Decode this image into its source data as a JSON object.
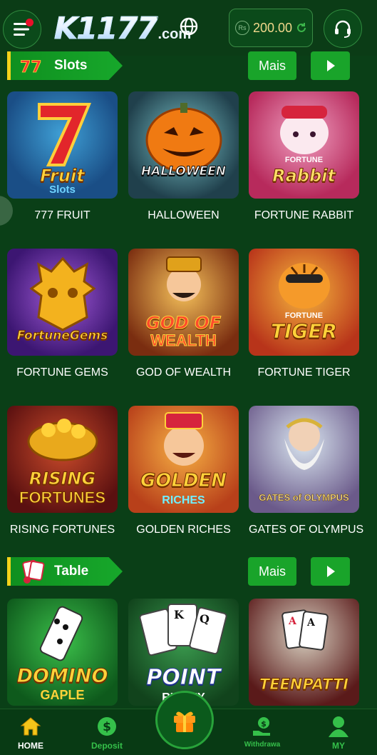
{
  "header": {
    "logo_main": "K1177",
    "logo_sub": ".com",
    "balance_currency": "Rs",
    "balance_amount": "200.00",
    "icons": [
      "menu-icon",
      "globe-icon",
      "refresh-icon",
      "headset-icon"
    ]
  },
  "sections": {
    "slots": {
      "label": "Slots",
      "more": "Mais"
    },
    "table": {
      "label": "Table",
      "more": "Mais"
    }
  },
  "games": {
    "slots": [
      {
        "name": "777 FRUIT",
        "art_title": "Fruit",
        "art_sub": "Slots"
      },
      {
        "name": "HALLOWEEN",
        "art_title": "HALLOWEEN",
        "art_sub": ""
      },
      {
        "name": "FORTUNE RABBIT",
        "art_title": "Rabbit",
        "art_sub": "FORTUNE"
      },
      {
        "name": "FORTUNE GEMS",
        "art_title": "FortuneGems",
        "art_sub": ""
      },
      {
        "name": "GOD OF WEALTH",
        "art_title": "GOD OF",
        "art_sub": "WEALTH"
      },
      {
        "name": "FORTUNE TIGER",
        "art_title": "TIGER",
        "art_sub": "FORTUNE"
      },
      {
        "name": "RISING FORTUNES",
        "art_title": "RISING",
        "art_sub": "FORTUNES"
      },
      {
        "name": "GOLDEN RICHES",
        "art_title": "GOLDEN",
        "art_sub": "RICHES"
      },
      {
        "name": "GATES OF OLYMPUS",
        "art_title": "",
        "art_sub": "GATES of OLYMPUS"
      }
    ],
    "table": [
      {
        "art_title": "DOMINO",
        "art_sub": "GAPLE"
      },
      {
        "art_title": "POINT",
        "art_sub": "RUMMY"
      },
      {
        "art_title": "TEENPATTI",
        "art_sub": ""
      }
    ]
  },
  "nav": {
    "home": "HOME",
    "deposit": "Deposit",
    "withdraw": "Withdrawa",
    "my": "MY"
  },
  "colors": {
    "background": "#0a3f17",
    "accent_green": "#19a42a",
    "nav_green": "#35c04a",
    "balance_gold": "#f1d88b"
  }
}
